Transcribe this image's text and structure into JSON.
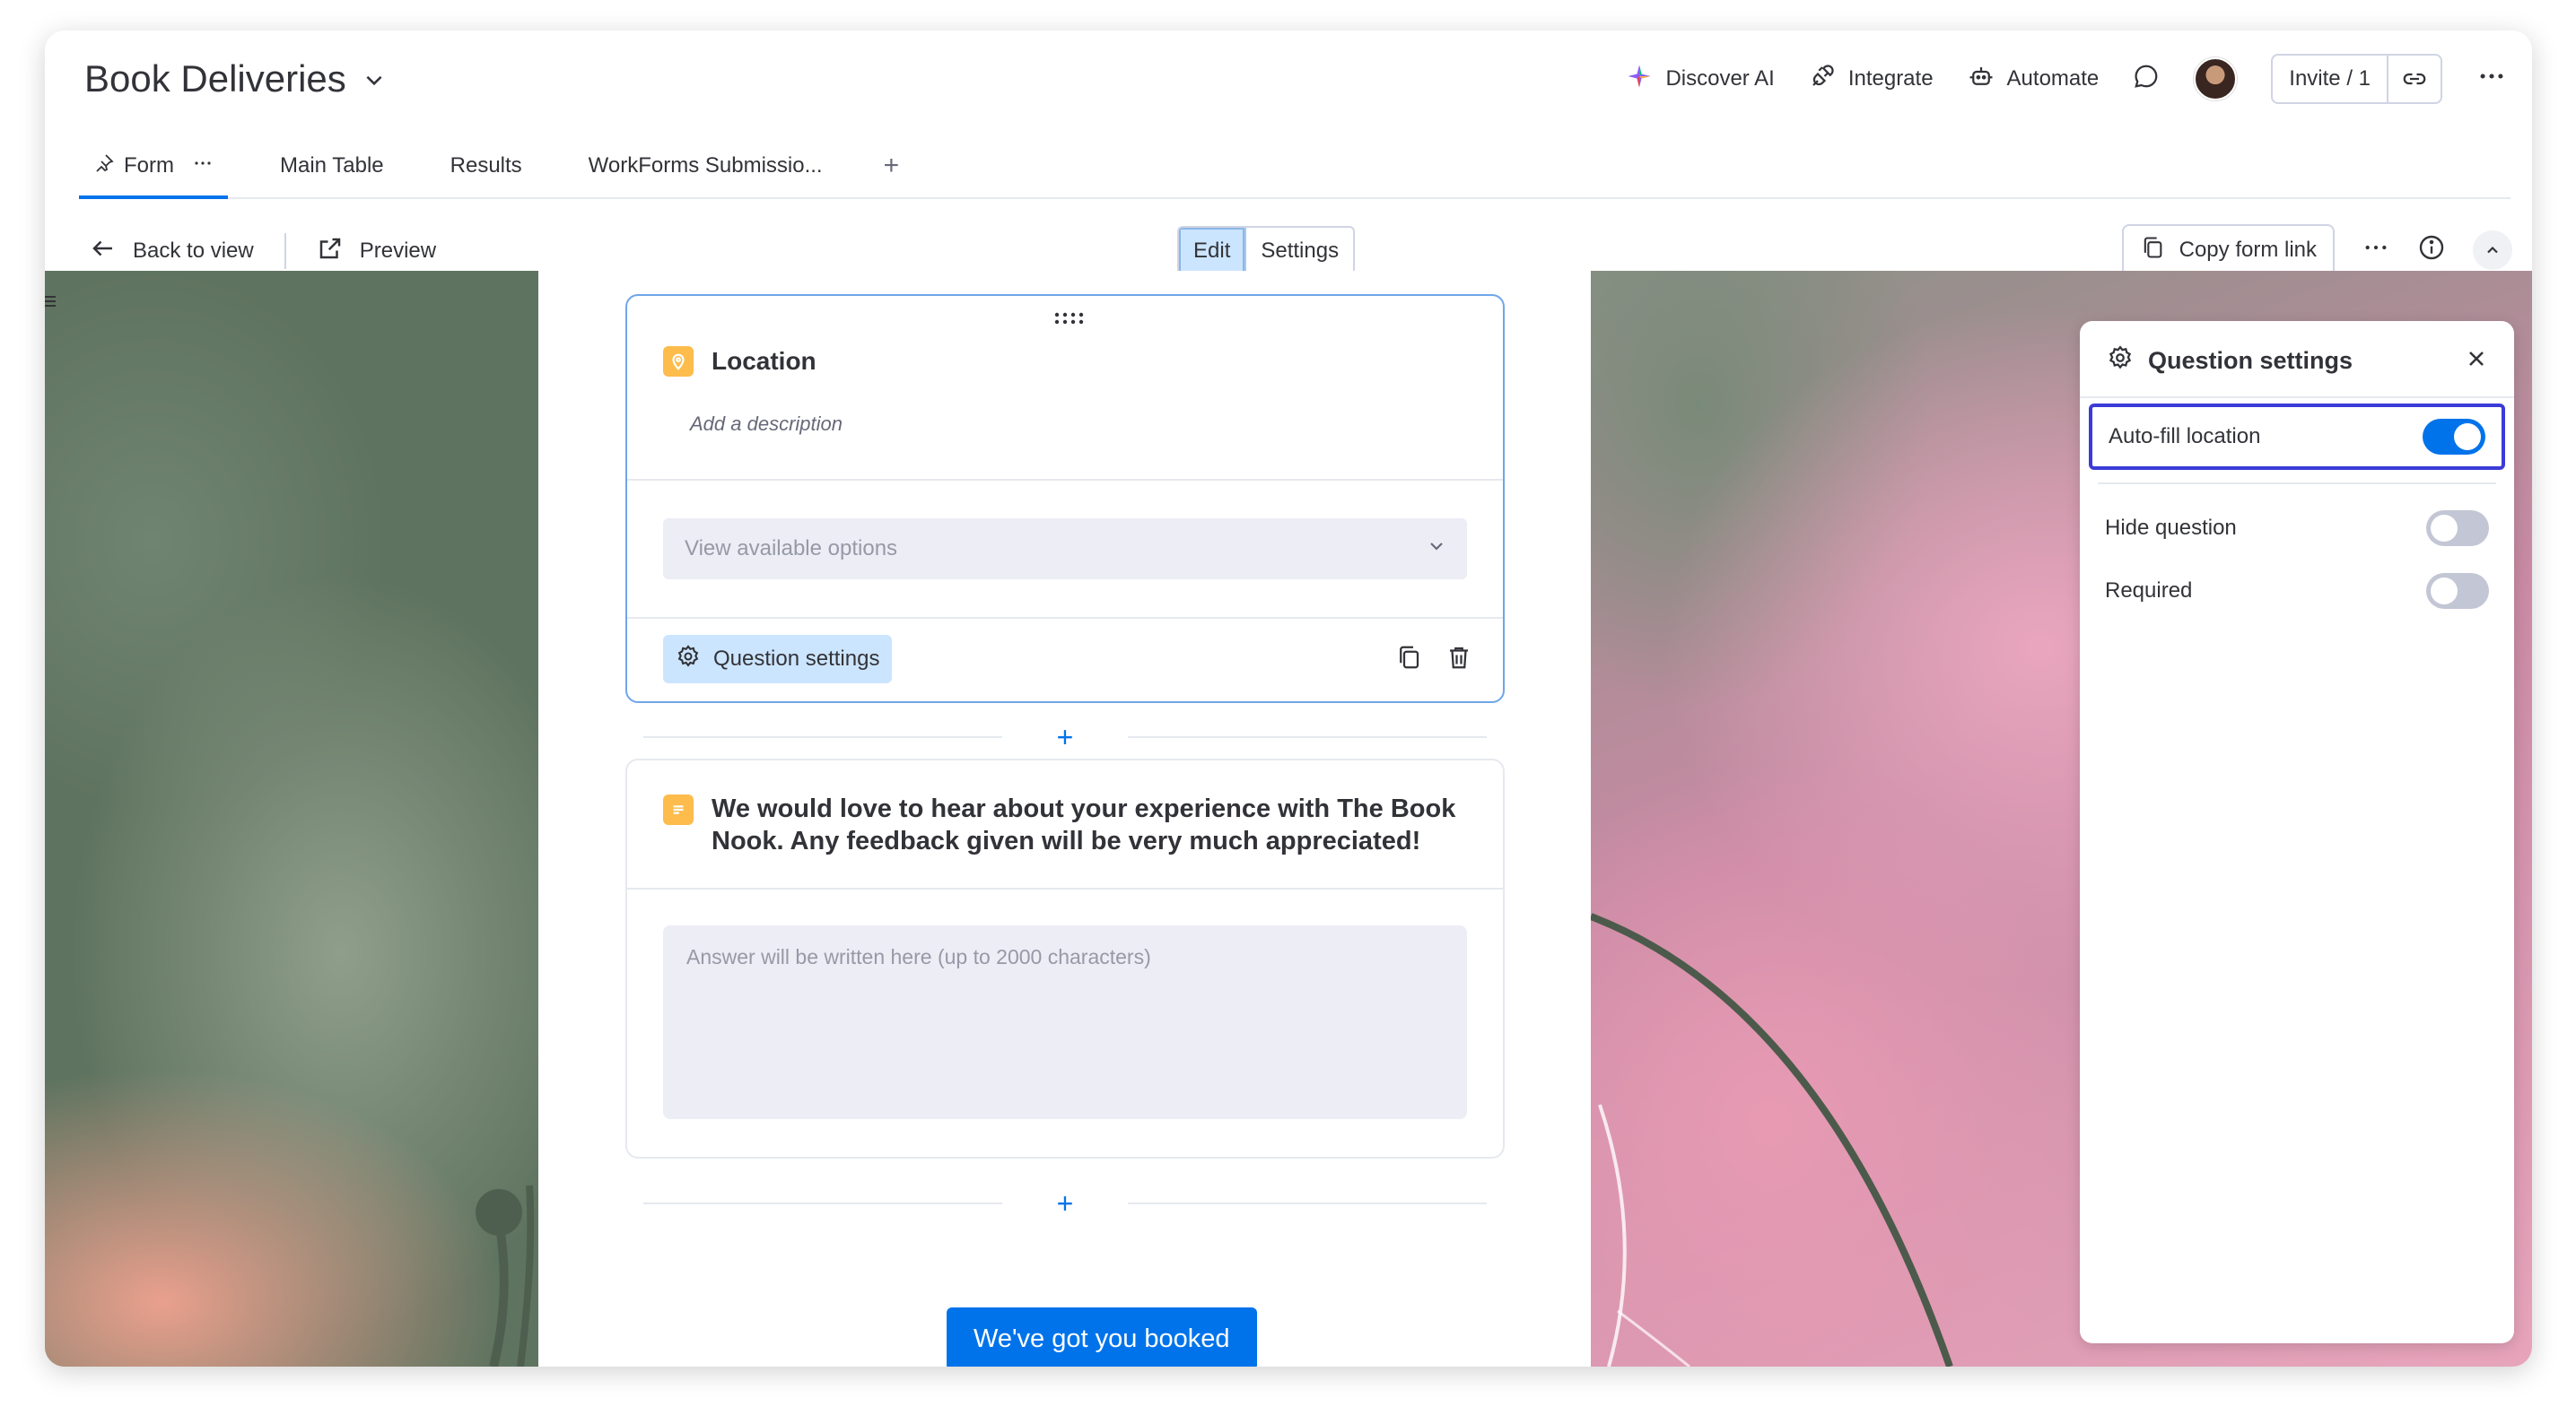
{
  "header": {
    "board_title": "Book Deliveries",
    "actions": {
      "discover_ai": "Discover AI",
      "integrate": "Integrate",
      "automate": "Automate",
      "invite": "Invite / 1"
    }
  },
  "tabs": [
    {
      "label": "Form",
      "active": true
    },
    {
      "label": "Main Table"
    },
    {
      "label": "Results"
    },
    {
      "label": "WorkForms Submissio..."
    }
  ],
  "toolbar": {
    "back": "Back to view",
    "preview": "Preview",
    "edit": "Edit",
    "settings": "Settings",
    "copy_link": "Copy form link"
  },
  "form": {
    "q1": {
      "title": "Location",
      "description": "Add a description",
      "placeholder": "View available options",
      "settings_button": "Question settings"
    },
    "q2": {
      "title": "We would love to hear about your experience with The Book Nook. Any feedback given will be very much appreciated!",
      "placeholder": "Answer will be written here (up to 2000 characters)"
    },
    "add_symbol": "+",
    "submit_label": "We've got you booked"
  },
  "panel": {
    "title": "Question settings",
    "options": [
      {
        "label": "Auto-fill location",
        "on": true
      },
      {
        "label": "Hide question",
        "on": false
      },
      {
        "label": "Required",
        "on": false
      }
    ]
  },
  "colors": {
    "accent": "#0073ea",
    "selected_bg": "#cce5ff",
    "question_icon": "#fdbc4b",
    "focus_ring": "#3b3bd8"
  }
}
